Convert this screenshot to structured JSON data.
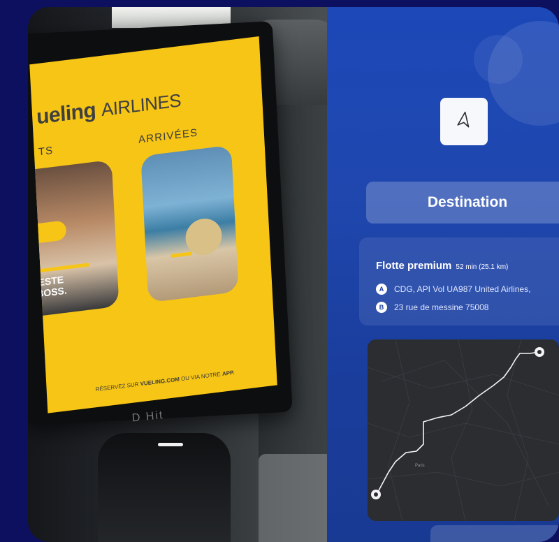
{
  "photo": {
    "brand_name": "ueling",
    "brand_suffix": "AIRLINES",
    "departures_fragment": "TS",
    "arrivals_title": "ARRIVÉES",
    "card_one_text_1": "DÉTESTE",
    "card_one_text_2": "ON BOSS.",
    "reserve_prefix": "RÉSERVEZ SUR ",
    "reserve_site": "VUELING.COM",
    "reserve_mid": " OU VIA NOTRE ",
    "reserve_app": "APP.",
    "device_logo": "D Hit"
  },
  "app": {
    "nav_icon": "navigation-arrow-icon",
    "destination_label": "Destination",
    "trip_title": "Flotte premium",
    "trip_meta": "52 min (25.1 km)",
    "stop_a_marker": "A",
    "stop_a_text": "CDG, API Vol UA987 United Airlines,",
    "stop_b_marker": "B",
    "stop_b_text": "23 rue de messine 75008",
    "map_city_label": "Paris"
  },
  "colors": {
    "background": "#0d0f5f",
    "brand_yellow": "#f6c516",
    "app_blue": "#1f47ae"
  }
}
